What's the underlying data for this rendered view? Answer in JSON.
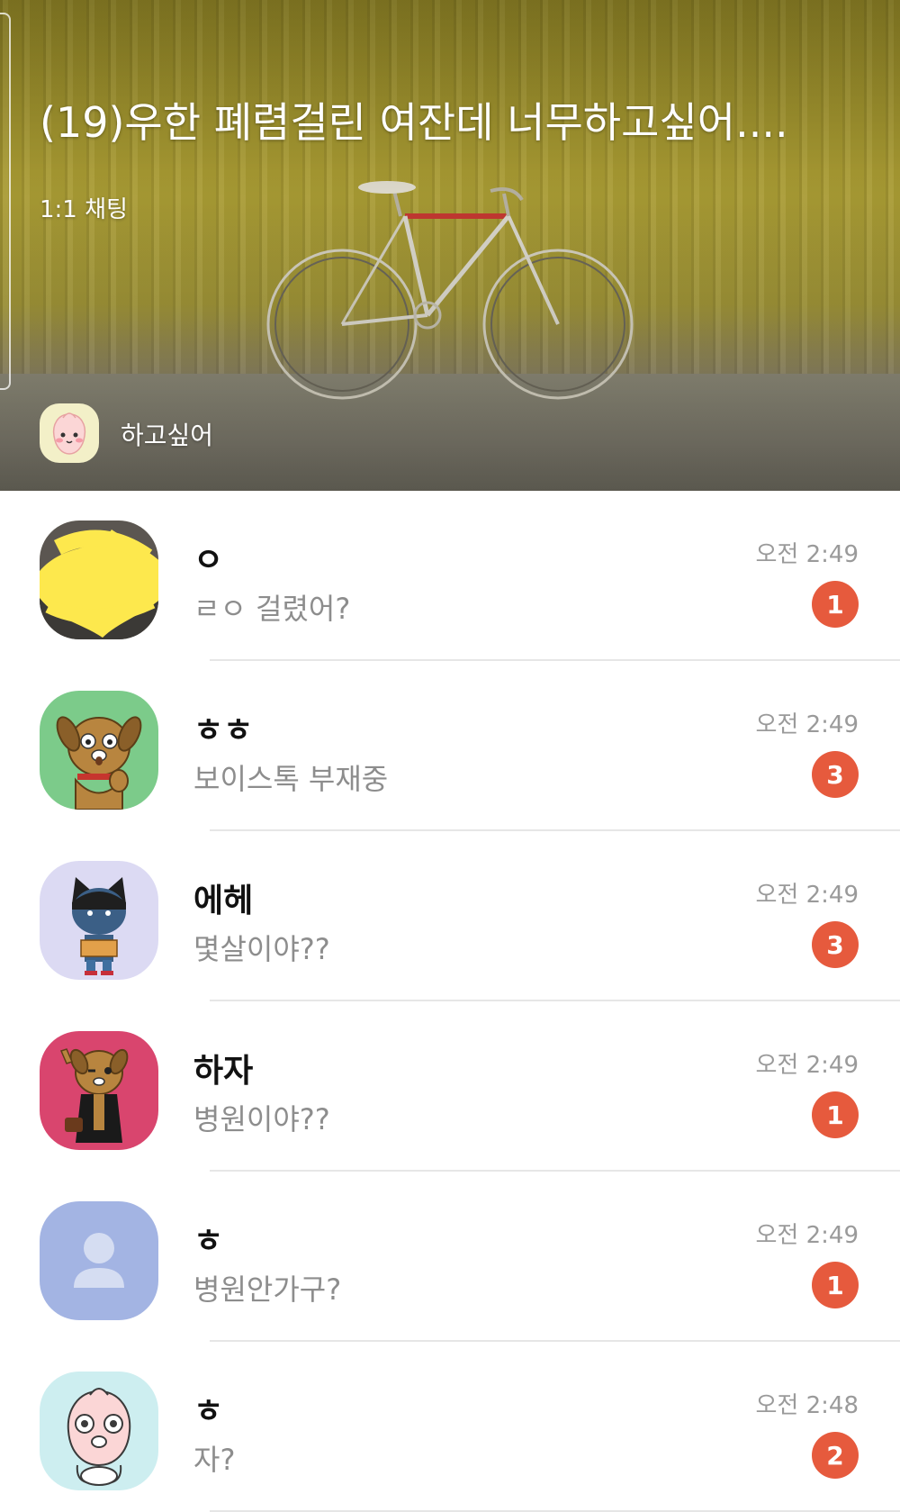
{
  "room": {
    "title": "(19)우한 폐렴걸린 여잔데 너무하고싶어....",
    "type": "1:1 채팅",
    "host_name": "하고싶어"
  },
  "chats": [
    {
      "name": "ㅇ",
      "preview": "ㄹㅇ 걸렸어?",
      "time": "오전 2:49",
      "unread": "1",
      "avatar": "photo-obscured"
    },
    {
      "name": "ㅎㅎ",
      "preview": "보이스톡 부재중",
      "time": "오전 2:49",
      "unread": "3",
      "avatar": "frodo-dog"
    },
    {
      "name": "에헤",
      "preview": "몇살이야??",
      "time": "오전 2:49",
      "unread": "3",
      "avatar": "neo-cat"
    },
    {
      "name": "하자",
      "preview": "병원이야??",
      "time": "오전 2:49",
      "unread": "1",
      "avatar": "frodo-dog-cool"
    },
    {
      "name": "ㅎ",
      "preview": "병원안가구?",
      "time": "오전 2:49",
      "unread": "1",
      "avatar": "default-person"
    },
    {
      "name": "ㅎ",
      "preview": "자?",
      "time": "오전 2:48",
      "unread": "2",
      "avatar": "apeach-crying"
    }
  ],
  "colors": {
    "badge": "#e65a3d",
    "time": "#9a9a9a",
    "preview": "#8d8d8d",
    "divider": "#e6e6e6",
    "avatar_bg": [
      "#e9e3cf",
      "#7ccb8a",
      "#dcdaf3",
      "#d9456e",
      "#a3b4e3",
      "#cdeef0"
    ]
  }
}
